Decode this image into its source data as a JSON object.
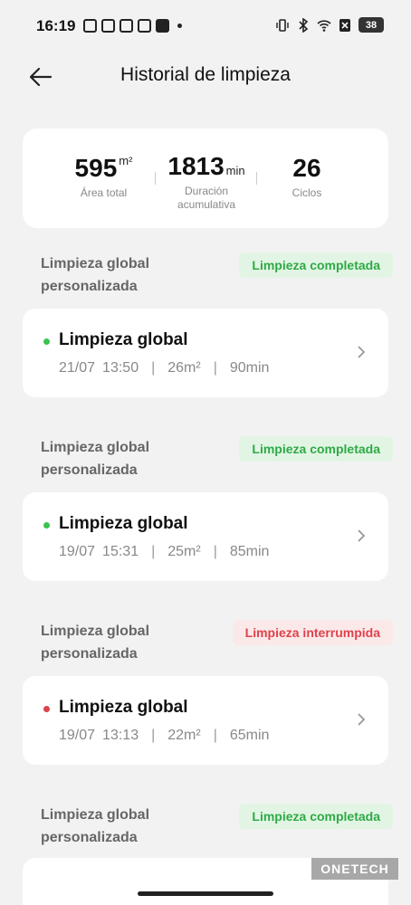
{
  "status_bar": {
    "time": "16:19",
    "battery": "38"
  },
  "header": {
    "title": "Historial de limpieza"
  },
  "summary": {
    "area": {
      "value": "595",
      "unit": "m²",
      "label": "Área total"
    },
    "duration": {
      "value": "1813",
      "unit": "min",
      "label_line1": "Duración",
      "label_line2": "acumulativa"
    },
    "cycles": {
      "value": "26",
      "label": "Ciclos"
    }
  },
  "records": [
    {
      "group_line1": "Limpieza global",
      "group_line2": "personalizada",
      "status": "Limpieza completada",
      "title": "Limpieza global",
      "date": "21/07",
      "time": "13:50",
      "area": "26m²",
      "duration": "90min"
    },
    {
      "group_line1": "Limpieza global",
      "group_line2": "personalizada",
      "status": "Limpieza completada",
      "title": "Limpieza global",
      "date": "19/07",
      "time": "15:31",
      "area": "25m²",
      "duration": "85min"
    },
    {
      "group_line1": "Limpieza global",
      "group_line2": "personalizada",
      "status": "Limpieza interrumpida",
      "title": "Limpieza global",
      "date": "19/07",
      "time": "13:13",
      "area": "22m²",
      "duration": "65min"
    },
    {
      "group_line1": "Limpieza global",
      "group_line2": "personalizada",
      "status": "Limpieza completada"
    }
  ],
  "watermark": "ONETECH",
  "colors": {
    "completed": "#2eaa46",
    "interrupted": "#e0424b"
  }
}
